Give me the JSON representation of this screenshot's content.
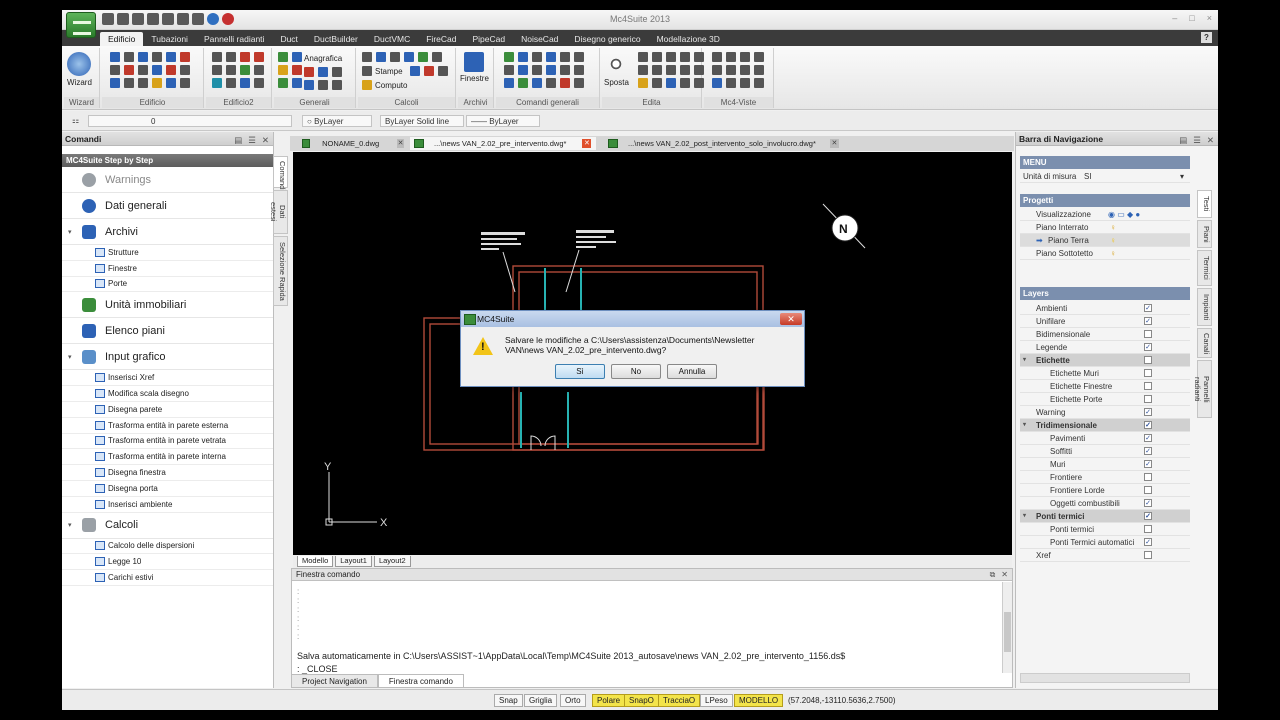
{
  "app": {
    "title": "Mc4Suite 2013",
    "window_controls": [
      "–",
      "□",
      "×"
    ],
    "quick_access": [
      "new-icon",
      "open-icon",
      "save-icon",
      "saveas-icon",
      "undo-icon",
      "redo-icon",
      "print-icon",
      "help-icon",
      "close-icon"
    ]
  },
  "ribbon": {
    "tabs": [
      "Edificio",
      "Tubazioni",
      "Pannelli radianti",
      "Duct",
      "DuctBuilder",
      "DuctVMC",
      "FireCad",
      "PipeCad",
      "NoiseCad",
      "Disegno generico",
      "Modellazione 3D"
    ],
    "active_tab": "Edificio",
    "help": "?",
    "groups": {
      "wizard": "Wizard",
      "edificio": "Edificio",
      "edificio2": "Edificio2",
      "generali": "Generali",
      "calcoli": "Calcoli",
      "archivi": "Archivi",
      "comandi_generali": "Comandi generali",
      "edita": "Edita",
      "mc4_viste": "Mc4-Viste"
    },
    "buttons": {
      "wizard": "Wizard",
      "anagrafica": "Anagrafica",
      "stampe": "Stampe",
      "computo": "Computo",
      "finestre": "Finestre",
      "sposta": "Sposta"
    }
  },
  "propbar": {
    "layer_value": "0",
    "color": "ByLayer",
    "linetype_label": "ByLayer",
    "linetype_name": "Solid line",
    "lineweight": "ByLayer"
  },
  "left_panel": {
    "title": "Comandi",
    "step_header": "MC4Suite Step by Step",
    "side_tabs": [
      "Comandi",
      "Dati estesi",
      "Selezione Rapida"
    ],
    "sections": [
      {
        "label": "Warnings",
        "toggle": "",
        "items": []
      },
      {
        "label": "Dati generali",
        "toggle": "",
        "items": []
      },
      {
        "label": "Archivi",
        "toggle": "▾",
        "items": [
          "Strutture",
          "Finestre",
          "Porte"
        ]
      },
      {
        "label": "Unità immobiliari",
        "toggle": "",
        "items": []
      },
      {
        "label": "Elenco piani",
        "toggle": "",
        "items": []
      },
      {
        "label": "Input grafico",
        "toggle": "▾",
        "items": [
          "Inserisci Xref",
          "Modifica scala disegno",
          "Disegna parete",
          "Trasforma entità in parete esterna",
          "Trasforma entità in parete vetrata",
          "Trasforma entità in parete interna",
          "Disegna finestra",
          "Disegna porta",
          "Inserisci ambiente"
        ]
      },
      {
        "label": "Calcoli",
        "toggle": "▾",
        "items": [
          "Calcolo delle dispersioni",
          "Legge 10",
          "Carichi estivi"
        ]
      }
    ]
  },
  "doc_tabs": [
    {
      "label": "NONAME_0.dwg",
      "active": false
    },
    {
      "label": "...\\news VAN_2.02_pre_intervento.dwg*",
      "active": true
    },
    {
      "label": "...\\news VAN_2.02_post_intervento_solo_involucro.dwg*",
      "active": false
    }
  ],
  "canvas": {
    "axis_y": "Y",
    "axis_x": "X",
    "north": "N"
  },
  "layout_tabs": [
    "Modello",
    "Layout1",
    "Layout2"
  ],
  "cmd": {
    "title": "Finestra comando",
    "autosave_line": "Salva automaticamente in C:\\Users\\ASSIST~1\\AppData\\Local\\Temp\\MC4Suite 2013_autosave\\news VAN_2.02_pre_intervento_1156.ds$",
    "close_line": ": _CLOSE",
    "bottom_tabs": [
      "Project Navigation",
      "Finestra comando"
    ]
  },
  "dialog": {
    "title": "MC4Suite",
    "close": "✕",
    "message": "Salvare le modifiche a C:\\Users\\assistenza\\Documents\\Newsletter VAN\\news VAN_2.02_pre_intervento.dwg?",
    "btn_yes": "Sì",
    "btn_no": "No",
    "btn_cancel": "Annulla"
  },
  "right_panel": {
    "title": "Barra di Navigazione",
    "menu_header": "MENU",
    "unit_label": "Unità di misura",
    "unit_value": "SI",
    "projects_header": "Progetti",
    "projects": [
      "Visualizzazione",
      "Piano Interrato",
      "Piano Terra",
      "Piano Sottotetto"
    ],
    "layers_header": "Layers",
    "side_tabs": [
      "Testi",
      "Piani",
      "Termici",
      "Impianti",
      "Canali",
      "Pannelli radianti"
    ],
    "layers": [
      {
        "label": "Ambienti",
        "level": 1,
        "checked": true,
        "group": false
      },
      {
        "label": "Unifilare",
        "level": 1,
        "checked": true,
        "group": false
      },
      {
        "label": "Bidimensionale",
        "level": 1,
        "checked": false,
        "group": false
      },
      {
        "label": "Legende",
        "level": 1,
        "checked": true,
        "group": false
      },
      {
        "label": "Etichette",
        "level": 1,
        "checked": false,
        "group": true
      },
      {
        "label": "Etichette Muri",
        "level": 2,
        "checked": false,
        "group": false
      },
      {
        "label": "Etichette Finestre",
        "level": 2,
        "checked": false,
        "group": false
      },
      {
        "label": "Etichette Porte",
        "level": 2,
        "checked": false,
        "group": false
      },
      {
        "label": "Warning",
        "level": 1,
        "checked": true,
        "group": false
      },
      {
        "label": "Tridimensionale",
        "level": 1,
        "checked": true,
        "group": true
      },
      {
        "label": "Pavimenti",
        "level": 2,
        "checked": true,
        "group": false
      },
      {
        "label": "Soffitti",
        "level": 2,
        "checked": true,
        "group": false
      },
      {
        "label": "Muri",
        "level": 2,
        "checked": true,
        "group": false
      },
      {
        "label": "Frontiere",
        "level": 2,
        "checked": false,
        "group": false
      },
      {
        "label": "Frontiere Lorde",
        "level": 2,
        "checked": false,
        "group": false
      },
      {
        "label": "Oggetti combustibili",
        "level": 2,
        "checked": true,
        "group": false
      },
      {
        "label": "Ponti termici",
        "level": 1,
        "checked": true,
        "group": true
      },
      {
        "label": "Ponti termici",
        "level": 2,
        "checked": false,
        "group": false
      },
      {
        "label": "Ponti Termici automatici",
        "level": 2,
        "checked": true,
        "group": false
      },
      {
        "label": "Xref",
        "level": 1,
        "checked": false,
        "group": false
      }
    ]
  },
  "statusbar": {
    "buttons": [
      {
        "label": "Snap",
        "on": false
      },
      {
        "label": "Griglia",
        "on": false
      },
      {
        "label": "Orto",
        "on": false
      },
      {
        "label": "Polare",
        "on": true
      },
      {
        "label": "SnapO",
        "on": true
      },
      {
        "label": "TracciaO",
        "on": true
      },
      {
        "label": "LPeso",
        "on": false
      },
      {
        "label": "MODELLO",
        "on": true
      }
    ],
    "coords": "(57.2048,-13110.5636,2.7500)"
  },
  "colors": {
    "ribbon_bg": "#3b3b3b",
    "wall": "#b14a3a",
    "window_cyan": "#27b3b3",
    "status_on": "#f3e44a"
  }
}
